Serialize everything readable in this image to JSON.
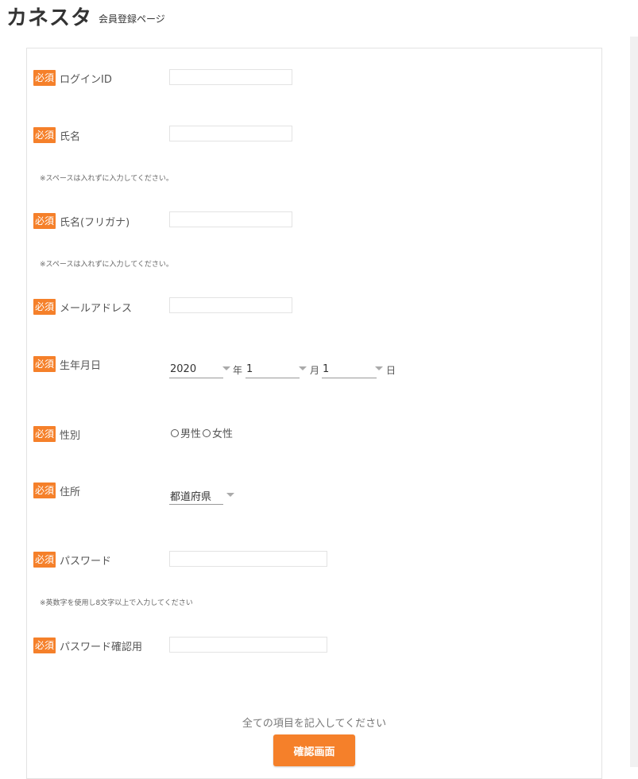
{
  "header": {
    "logo_text": "カネスタ",
    "page_title": "会員登録ページ"
  },
  "required_badge": "必須",
  "fields": {
    "login_id": {
      "label": "ログインID",
      "value": ""
    },
    "name": {
      "label": "氏名",
      "value": "",
      "note": "※スペースは入れずに入力してください。"
    },
    "name_kana": {
      "label": "氏名(フリガナ)",
      "value": "",
      "note": "※スペースは入れずに入力してください。"
    },
    "email": {
      "label": "メールアドレス",
      "value": ""
    },
    "birthdate": {
      "label": "生年月日",
      "year": "2020",
      "year_unit": "年",
      "month": "1",
      "month_unit": "月",
      "day": "1",
      "day_unit": "日"
    },
    "gender": {
      "label": "性別",
      "options": [
        "男性",
        "女性"
      ]
    },
    "address": {
      "label": "住所",
      "prefecture": "都道府県"
    },
    "password": {
      "label": "パスワード",
      "value": "",
      "note": "※英数字を使用し8文字以上で入力してください"
    },
    "password_confirm": {
      "label": "パスワード確認用",
      "value": ""
    }
  },
  "footer": {
    "message": "全ての項目を記入してください",
    "confirm_button": "確認画面"
  },
  "colors": {
    "accent": "#f5802a"
  }
}
